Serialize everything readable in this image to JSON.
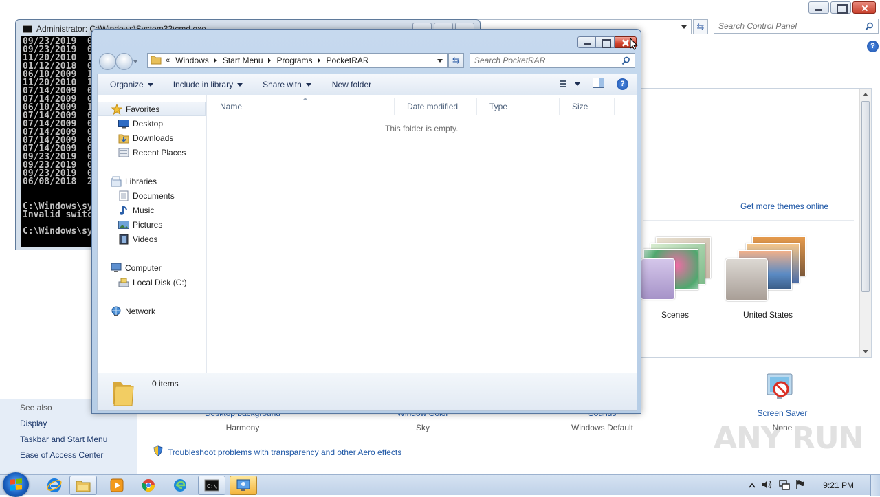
{
  "control_panel": {
    "search_placeholder": "Search Control Panel",
    "help_glyph": "?",
    "get_more_themes": "Get more themes online",
    "themes": [
      {
        "label": "Scenes"
      },
      {
        "label": "United States"
      }
    ],
    "bottom_items": [
      {
        "link": "Desktop background",
        "value": "Harmony"
      },
      {
        "link": "Window Color",
        "value": "Sky"
      },
      {
        "link": "Sounds",
        "value": "Windows Default"
      },
      {
        "link": "Screen Saver",
        "value": "None"
      }
    ],
    "troubleshoot_link": "Troubleshoot problems with transparency and other Aero effects",
    "see_also": {
      "header": "See also",
      "links": [
        "Display",
        "Taskbar and Start Menu",
        "Ease of Access Center"
      ]
    }
  },
  "cmd": {
    "title": "Administrator: C:\\Windows\\System32\\cmd.exe",
    "lines": [
      "09/23/2019  0",
      "09/23/2019  0",
      "11/20/2010  1",
      "01/12/2018  0",
      "06/10/2009  1",
      "11/20/2010  1",
      "07/14/2009  0",
      "07/14/2009  0",
      "06/10/2009  1",
      "07/14/2009  0",
      "07/14/2009  0",
      "07/14/2009  0",
      "07/14/2009  0",
      "07/14/2009  0",
      "09/23/2019  0",
      "09/23/2019  0",
      "09/23/2019  0",
      "06/08/2018  2",
      "",
      "",
      "C:\\Windows\\sy",
      "Invalid switc",
      "",
      "C:\\Windows\\sy"
    ]
  },
  "explorer": {
    "breadcrumb_prefix": "«",
    "breadcrumb": [
      "Windows",
      "Start Menu",
      "Programs",
      "PocketRAR"
    ],
    "search_placeholder": "Search PocketRAR",
    "toolbar": {
      "organize": "Organize",
      "include_in_library": "Include in library",
      "share_with": "Share with",
      "new_folder": "New folder",
      "help_glyph": "?"
    },
    "nav": {
      "favorites": {
        "label": "Favorites",
        "items": [
          "Desktop",
          "Downloads",
          "Recent Places"
        ]
      },
      "libraries": {
        "label": "Libraries",
        "items": [
          "Documents",
          "Music",
          "Pictures",
          "Videos"
        ]
      },
      "computer": {
        "label": "Computer",
        "items": [
          "Local Disk (C:)"
        ]
      },
      "network": {
        "label": "Network"
      }
    },
    "columns": [
      "Name",
      "Date modified",
      "Type",
      "Size"
    ],
    "empty_message": "This folder is empty.",
    "item_count": "0 items"
  },
  "taskbar": {
    "apps": [
      "internet-explorer",
      "windows-explorer",
      "media-player",
      "chrome",
      "edge",
      "cmd",
      "control-panel"
    ],
    "clock": "9:21 PM"
  },
  "watermark": "ANY RUN",
  "colors": {
    "link_blue": "#1e57a6",
    "close_red": "#d2432d",
    "window_frame": "#c6d9ee",
    "taskbar": "#bfd1e8"
  }
}
